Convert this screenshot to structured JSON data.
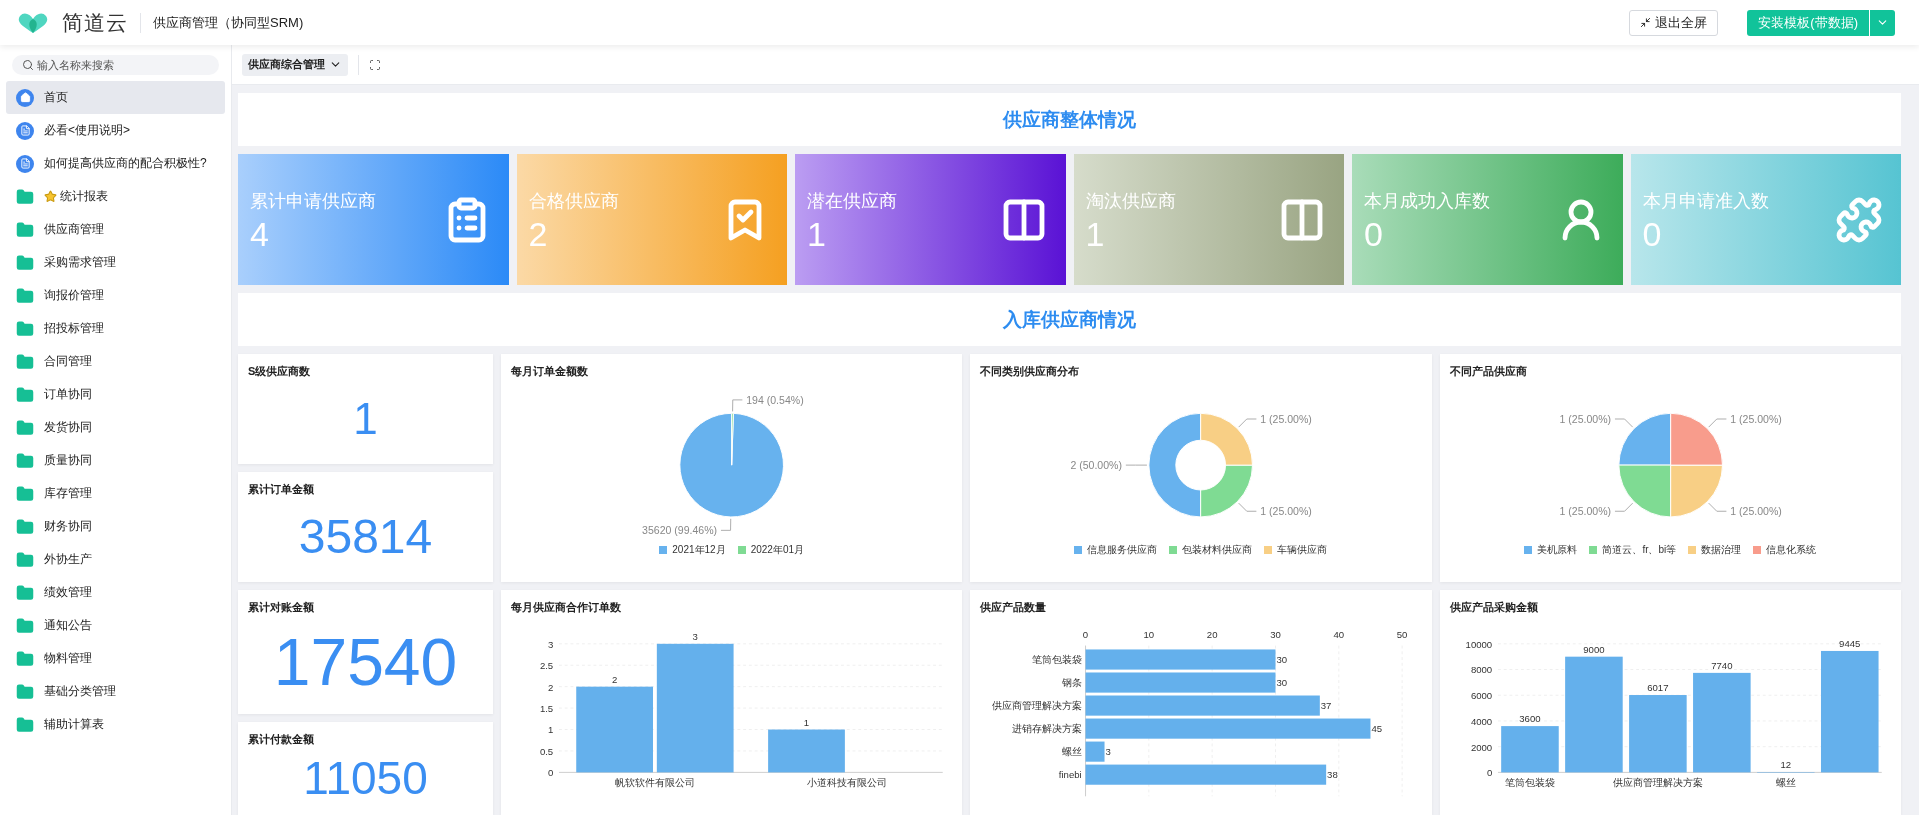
{
  "header": {
    "logo": "简道云",
    "app_title": "供应商管理（协同型SRM)",
    "buttons": [
      {
        "label": "退出全屏",
        "kind": "exit"
      },
      {
        "label": "安装模板(带数据)",
        "kind": "primary"
      }
    ]
  },
  "sidebar": {
    "search": {
      "placeholder": "输入名称来搜索"
    },
    "items": [
      {
        "label": "首页",
        "kind": "home",
        "selected": true,
        "starred": false
      },
      {
        "label": "必看<使用说明>",
        "kind": "doc",
        "selected": false,
        "starred": false
      },
      {
        "label": "如何提高供应商的配合积极性?",
        "kind": "doc",
        "selected": false,
        "starred": false
      },
      {
        "label": "统计报表",
        "kind": "folder",
        "selected": false,
        "starred": true
      },
      {
        "label": "供应商管理",
        "kind": "folder",
        "selected": false,
        "starred": false
      },
      {
        "label": "采购需求管理",
        "kind": "folder",
        "selected": false,
        "starred": false
      },
      {
        "label": "询报价管理",
        "kind": "folder",
        "selected": false,
        "starred": false
      },
      {
        "label": "招投标管理",
        "kind": "folder",
        "selected": false,
        "starred": false
      },
      {
        "label": "合同管理",
        "kind": "folder",
        "selected": false,
        "starred": false
      },
      {
        "label": "订单协同",
        "kind": "folder",
        "selected": false,
        "starred": false
      },
      {
        "label": "发货协同",
        "kind": "folder",
        "selected": false,
        "starred": false
      },
      {
        "label": "质量协同",
        "kind": "folder",
        "selected": false,
        "starred": false
      },
      {
        "label": "库存管理",
        "kind": "folder",
        "selected": false,
        "starred": false
      },
      {
        "label": "财务协同",
        "kind": "folder",
        "selected": false,
        "starred": false
      },
      {
        "label": "外协生产",
        "kind": "folder",
        "selected": false,
        "starred": false
      },
      {
        "label": "绩效管理",
        "kind": "folder",
        "selected": false,
        "starred": false
      },
      {
        "label": "通知公告",
        "kind": "folder",
        "selected": false,
        "starred": false
      },
      {
        "label": "物料管理",
        "kind": "folder",
        "selected": false,
        "starred": false
      },
      {
        "label": "基础分类管理",
        "kind": "folder",
        "selected": false,
        "starred": false
      },
      {
        "label": "辅助计算表",
        "kind": "folder",
        "selected": false,
        "starred": false
      }
    ]
  },
  "toolbar": {
    "dashboard_select": "供应商综合管理"
  },
  "overview": {
    "title": "供应商整体情况",
    "cards": [
      {
        "label": "累计申请供应商",
        "value": "4"
      },
      {
        "label": "合格供应商",
        "value": "2"
      },
      {
        "label": "潜在供应商",
        "value": "1"
      },
      {
        "label": "淘汰供应商",
        "value": "1"
      },
      {
        "label": "本月成功入库数",
        "value": "0"
      },
      {
        "label": "本月申请准入数",
        "value": "0"
      }
    ]
  },
  "inbound": {
    "title": "入库供应商情况",
    "stats": [
      {
        "title": "S级供应商数",
        "value": "1"
      },
      {
        "title": "累计订单金额",
        "value": "35814"
      },
      {
        "title": "累计对账金额",
        "value": "17540"
      },
      {
        "title": "累计付款金额",
        "value": "11050"
      }
    ],
    "charts": [
      {
        "title": "每月订单金额数",
        "chart_data": {
          "type": "pie",
          "categories": [
            "2021年12月",
            "2022年01月"
          ],
          "values": [
            35620,
            194
          ],
          "value_labels": [
            "35620 (99.46%)",
            "194 (0.54%)"
          ]
        }
      },
      {
        "title": "不同类别供应商分布",
        "chart_data": {
          "type": "donut",
          "categories": [
            "信息服务供应商",
            "包装材料供应商",
            "车辆供应商"
          ],
          "values": [
            2,
            1,
            1
          ],
          "value_labels": [
            "2 (50.00%)",
            "1 (25.00%)",
            "1 (25.00%)"
          ]
        }
      },
      {
        "title": "不同产品供应商",
        "chart_data": {
          "type": "pie",
          "categories": [
            "美机原料",
            "简道云、fr、bi等",
            "数据治理",
            "信息化系统"
          ],
          "values": [
            1,
            1,
            1,
            1
          ],
          "value_labels": [
            "1 (25.00%)",
            "1 (25.00%)",
            "1 (25.00%)",
            "1 (25.00%)"
          ]
        }
      },
      {
        "title": "每月供应商合作订单数",
        "chart_data": {
          "type": "bar",
          "orientation": "vertical",
          "categories": [
            "帆软软件有限公司",
            "小道科技有限公司"
          ],
          "series": [
            {
              "values": [
                2,
                1
              ]
            },
            {
              "values": [
                3,
                null
              ]
            }
          ],
          "ylim": [
            0,
            3
          ],
          "yticks": [
            0,
            0.5,
            1,
            1.5,
            2,
            2.5,
            3
          ],
          "grid": true,
          "data_labels": true
        }
      },
      {
        "title": "供应产品数量",
        "chart_data": {
          "type": "bar",
          "orientation": "horizontal",
          "categories": [
            "笔筒包装袋",
            "钢条",
            "供应商管理解决方案",
            "进销存解决方案",
            "螺丝",
            "finebi"
          ],
          "values": [
            30,
            30,
            37,
            45,
            3,
            38
          ],
          "xlim": [
            0,
            50
          ],
          "xticks": [
            0,
            10,
            20,
            30,
            40,
            50
          ],
          "grid": true,
          "data_labels": true
        }
      },
      {
        "title": "供应产品采购金额",
        "chart_data": {
          "type": "bar",
          "orientation": "vertical",
          "categories": [
            "笔筒包装袋",
            null,
            "供应商管理解决方案",
            null,
            "螺丝",
            null
          ],
          "values": [
            3600,
            9000,
            6017,
            7740,
            12,
            9445
          ],
          "ylim": [
            0,
            10000
          ],
          "yticks": [
            0,
            2000,
            4000,
            6000,
            8000,
            10000
          ],
          "grid": true,
          "data_labels": true
        }
      }
    ]
  }
}
